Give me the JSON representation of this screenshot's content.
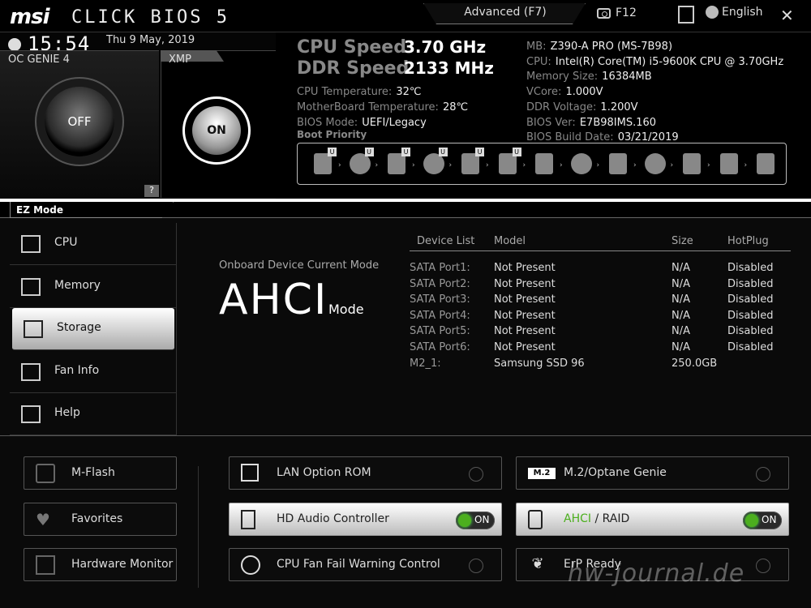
{
  "header": {
    "logo_brand": "msi",
    "logo_product": "CLICK BIOS 5",
    "advanced_tab": "Advanced (F7)",
    "screenshot_key": "F12",
    "language": "English",
    "close": "✕"
  },
  "clock": {
    "time": "15:54",
    "date": "Thu  9 May, 2019"
  },
  "oc_genie": {
    "label": "OC GENIE 4",
    "state": "OFF"
  },
  "xmp": {
    "label": "XMP",
    "state": "ON"
  },
  "help_button": "?",
  "speeds": {
    "cpu_label": "CPU Speed",
    "cpu_value": "3.70 GHz",
    "ddr_label": "DDR Speed",
    "ddr_value": "2133 MHz"
  },
  "temps": {
    "cpu_temp_label": "CPU Temperature:",
    "cpu_temp_value": "32℃",
    "mb_temp_label": "MotherBoard Temperature:",
    "mb_temp_value": "28℃",
    "bios_mode_label": "BIOS Mode:",
    "bios_mode_value": "UEFI/Legacy",
    "boot_priority_label": "Boot Priority"
  },
  "sysinfo": [
    {
      "label": "MB:",
      "value": "Z390-A PRO (MS-7B98)"
    },
    {
      "label": "CPU:",
      "value": "Intel(R) Core(TM) i5-9600K CPU @ 3.70GHz"
    },
    {
      "label": "Memory Size:",
      "value": "16384MB"
    },
    {
      "label": "VCore:",
      "value": "1.000V"
    },
    {
      "label": "DDR Voltage:",
      "value": "1.200V"
    },
    {
      "label": "BIOS Ver:",
      "value": "E7B98IMS.160"
    },
    {
      "label": "BIOS Build Date:",
      "value": "03/21/2019"
    }
  ],
  "boot_devices": [
    {
      "type": "hdd-icon",
      "u": "U"
    },
    {
      "type": "optical-icon",
      "u": "U"
    },
    {
      "type": "usb-hdd-icon",
      "u": "U"
    },
    {
      "type": "usb-optical-icon",
      "u": "U"
    },
    {
      "type": "usb-key-icon",
      "u": "U"
    },
    {
      "type": "network-icon",
      "u": "U"
    },
    {
      "type": "hdd-icon",
      "u": ""
    },
    {
      "type": "optical-icon",
      "u": ""
    },
    {
      "type": "usb-hdd-icon",
      "u": ""
    },
    {
      "type": "usb-optical-icon",
      "u": ""
    },
    {
      "type": "usb-key-icon",
      "u": ""
    },
    {
      "type": "usb-floppy-icon",
      "u": ""
    },
    {
      "type": "network-icon",
      "u": ""
    }
  ],
  "ez_mode": "EZ Mode",
  "nav": [
    {
      "label": "CPU",
      "icon": "cpu-icon"
    },
    {
      "label": "Memory",
      "icon": "memory-icon"
    },
    {
      "label": "Storage",
      "icon": "storage-icon",
      "active": true
    },
    {
      "label": "Fan Info",
      "icon": "fan-icon"
    },
    {
      "label": "Help",
      "icon": "hotkey-icon"
    }
  ],
  "storage": {
    "onboard_label": "Onboard Device Current Mode",
    "mode": "AHCI",
    "mode_suffix": "Mode",
    "columns": [
      "Device List",
      "Model",
      "Size",
      "HotPlug"
    ],
    "rows": [
      [
        "SATA Port1:",
        "Not Present",
        "N/A",
        "Disabled"
      ],
      [
        "SATA Port2:",
        "Not Present",
        "N/A",
        "Disabled"
      ],
      [
        "SATA Port3:",
        "Not Present",
        "N/A",
        "Disabled"
      ],
      [
        "SATA Port4:",
        "Not Present",
        "N/A",
        "Disabled"
      ],
      [
        "SATA Port5:",
        "Not Present",
        "N/A",
        "Disabled"
      ],
      [
        "SATA Port6:",
        "Not Present",
        "N/A",
        "Disabled"
      ],
      [
        "M2_1:",
        "Samsung SSD 96",
        "250.0GB",
        ""
      ]
    ]
  },
  "func_buttons": {
    "mflash": "M-Flash",
    "favorites": "Favorites",
    "hw_monitor": "Hardware Monitor",
    "lan_rom": "LAN Option ROM",
    "hd_audio": "HD Audio Controller",
    "cpu_fan_warn": "CPU Fan Fail Warning Control",
    "m2_optane": "M.2/Optane Genie",
    "m2_badge": "M.2",
    "ahci_raid_a": "AHCI",
    "ahci_raid_b": " / RAID",
    "erp": "ErP Ready",
    "on": "ON"
  },
  "watermark": "hw-journal.de",
  "colors": {
    "accent_green": "#4caf1e",
    "background": "#000000"
  }
}
